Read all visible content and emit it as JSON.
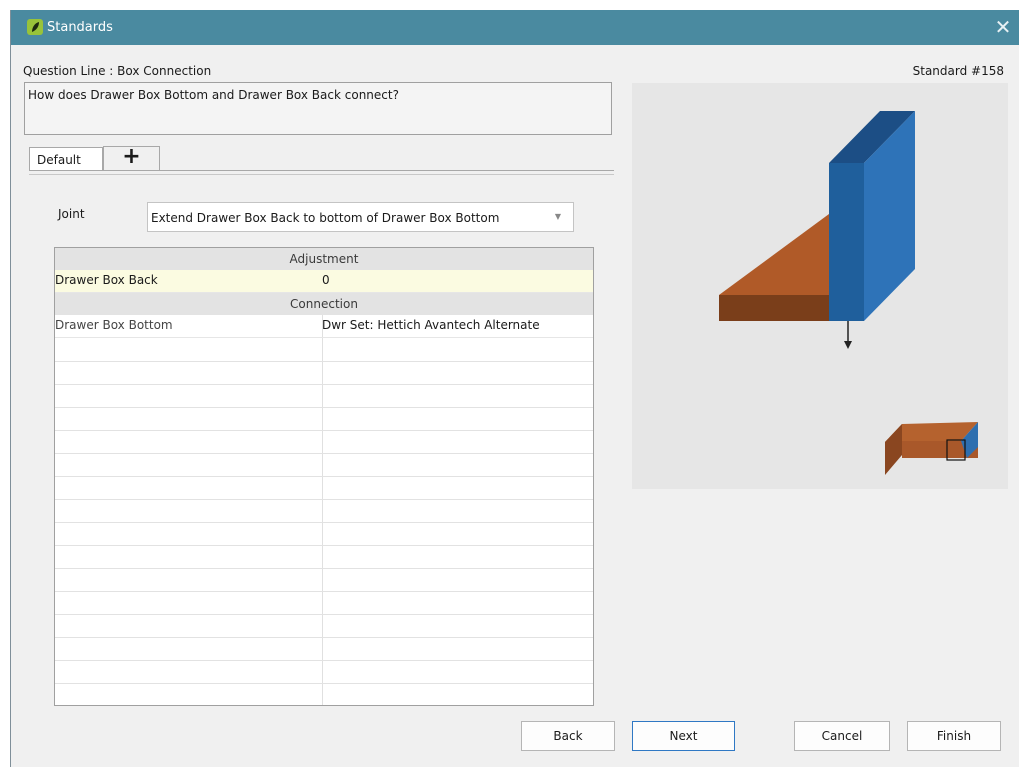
{
  "window": {
    "title": "Standards",
    "close_glyph": "✕"
  },
  "header": {
    "question_line": "Question Line : Box Connection",
    "standard_number": "Standard #158"
  },
  "question_text": "How does Drawer Box Bottom and Drawer Box Back connect?",
  "tabs": [
    {
      "label": "Default"
    },
    {
      "label": "+"
    }
  ],
  "joint": {
    "label": "Joint",
    "value": "Extend Drawer Box Back to bottom of Drawer Box Bottom",
    "arrow": "▼"
  },
  "grid": {
    "adjustment_header": "Adjustment",
    "adjustment_rows": [
      {
        "name": "Drawer Box Back",
        "value": "0"
      }
    ],
    "connection_header": "Connection",
    "connection_rows": [
      {
        "name": "Drawer Box Bottom",
        "value": "Dwr Set: Hettich Avantech Alternate"
      }
    ]
  },
  "preview": {
    "colors": {
      "panel_blue": "#2e6faf",
      "panel_blue_dark": "#1f5a94",
      "board_brown": "#a9582a",
      "board_brown_dark": "#7d3f1b",
      "background": "#e6e6e6"
    }
  },
  "buttons": {
    "back": "Back",
    "next": "Next",
    "cancel": "Cancel",
    "finish": "Finish"
  }
}
